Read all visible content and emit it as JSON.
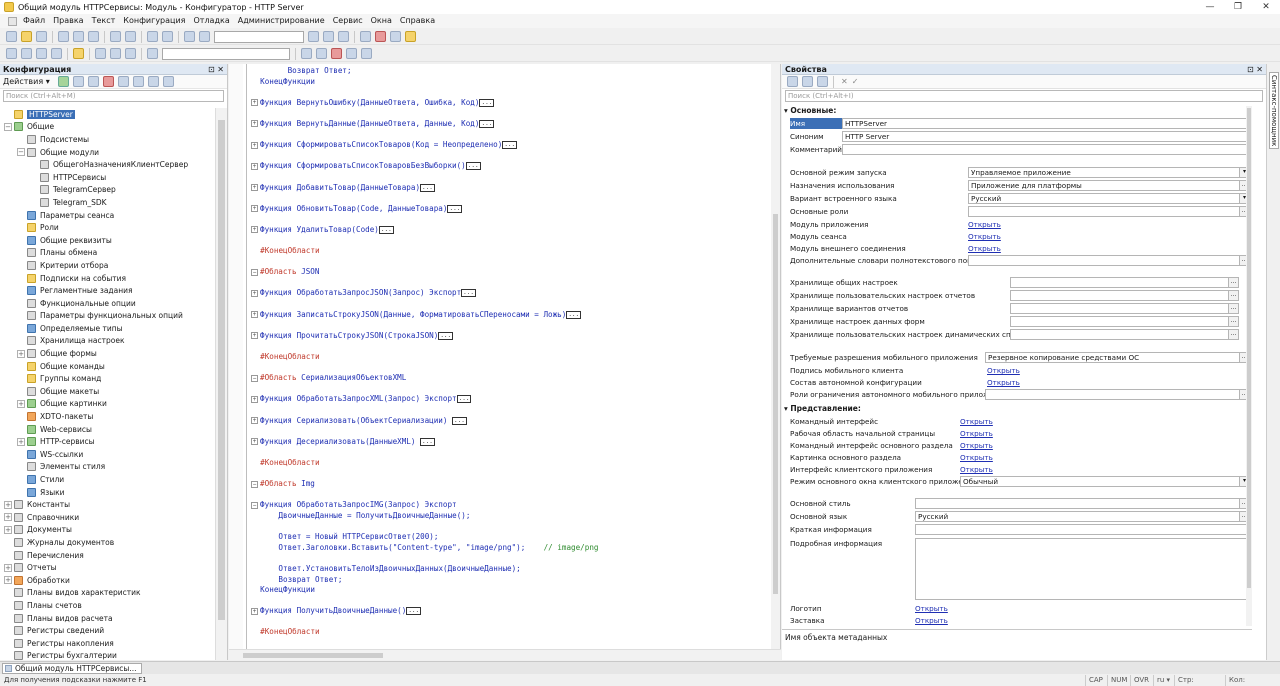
{
  "window": {
    "title": "Общий модуль HTTPСервисы: Модуль - Конфигуратор - HTTP Server",
    "min": "—",
    "max": "❐",
    "close": "✕"
  },
  "menu": [
    "Файл",
    "Правка",
    "Текст",
    "Конфигурация",
    "Отладка",
    "Администрирование",
    "Сервис",
    "Окна",
    "Справка"
  ],
  "left": {
    "title": "Конфигурация",
    "actions": "Действия ▾",
    "search_placeholder": "Поиск (Ctrl+Alt+M)",
    "tree": [
      {
        "label": "HTTPServer",
        "lvl": 0,
        "exp": "",
        "ic": "y",
        "sel": true
      },
      {
        "label": "Общие",
        "lvl": 0,
        "exp": "−",
        "ic": "g"
      },
      {
        "label": "Подсистемы",
        "lvl": 1,
        "exp": "",
        "ic": "d"
      },
      {
        "label": "Общие модули",
        "lvl": 1,
        "exp": "−",
        "ic": "d"
      },
      {
        "label": "ОбщегоНазначенияКлиентСервер",
        "lvl": 2,
        "exp": "",
        "ic": "d"
      },
      {
        "label": "HTTPСервисы",
        "lvl": 2,
        "exp": "",
        "ic": "d"
      },
      {
        "label": "TelegramСервер",
        "lvl": 2,
        "exp": "",
        "ic": "d"
      },
      {
        "label": "Telegram_SDK",
        "lvl": 2,
        "exp": "",
        "ic": "d"
      },
      {
        "label": "Параметры сеанса",
        "lvl": 1,
        "exp": "",
        "ic": "b"
      },
      {
        "label": "Роли",
        "lvl": 1,
        "exp": "",
        "ic": "y"
      },
      {
        "label": "Общие реквизиты",
        "lvl": 1,
        "exp": "",
        "ic": "b"
      },
      {
        "label": "Планы обмена",
        "lvl": 1,
        "exp": "",
        "ic": "d"
      },
      {
        "label": "Критерии отбора",
        "lvl": 1,
        "exp": "",
        "ic": "d"
      },
      {
        "label": "Подписки на события",
        "lvl": 1,
        "exp": "",
        "ic": "y"
      },
      {
        "label": "Регламентные задания",
        "lvl": 1,
        "exp": "",
        "ic": "b"
      },
      {
        "label": "Функциональные опции",
        "lvl": 1,
        "exp": "",
        "ic": "d"
      },
      {
        "label": "Параметры функциональных опций",
        "lvl": 1,
        "exp": "",
        "ic": "d"
      },
      {
        "label": "Определяемые типы",
        "lvl": 1,
        "exp": "",
        "ic": "b"
      },
      {
        "label": "Хранилища настроек",
        "lvl": 1,
        "exp": "",
        "ic": "d"
      },
      {
        "label": "Общие формы",
        "lvl": 1,
        "exp": "+",
        "ic": "d"
      },
      {
        "label": "Общие команды",
        "lvl": 1,
        "exp": "",
        "ic": "y"
      },
      {
        "label": "Группы команд",
        "lvl": 1,
        "exp": "",
        "ic": "y"
      },
      {
        "label": "Общие макеты",
        "lvl": 1,
        "exp": "",
        "ic": "d"
      },
      {
        "label": "Общие картинки",
        "lvl": 1,
        "exp": "+",
        "ic": "g"
      },
      {
        "label": "XDTO-пакеты",
        "lvl": 1,
        "exp": "",
        "ic": "o"
      },
      {
        "label": "Web-сервисы",
        "lvl": 1,
        "exp": "",
        "ic": "g"
      },
      {
        "label": "HTTP-сервисы",
        "lvl": 1,
        "exp": "+",
        "ic": "g"
      },
      {
        "label": "WS-ссылки",
        "lvl": 1,
        "exp": "",
        "ic": "b"
      },
      {
        "label": "Элементы стиля",
        "lvl": 1,
        "exp": "",
        "ic": "d"
      },
      {
        "label": "Стили",
        "lvl": 1,
        "exp": "",
        "ic": "b"
      },
      {
        "label": "Языки",
        "lvl": 1,
        "exp": "",
        "ic": "b"
      },
      {
        "label": "Константы",
        "lvl": 0,
        "exp": "+",
        "ic": "d"
      },
      {
        "label": "Справочники",
        "lvl": 0,
        "exp": "+",
        "ic": "d"
      },
      {
        "label": "Документы",
        "lvl": 0,
        "exp": "+",
        "ic": "d"
      },
      {
        "label": "Журналы документов",
        "lvl": 0,
        "exp": "",
        "ic": "d"
      },
      {
        "label": "Перечисления",
        "lvl": 0,
        "exp": "",
        "ic": "d"
      },
      {
        "label": "Отчеты",
        "lvl": 0,
        "exp": "+",
        "ic": "d"
      },
      {
        "label": "Обработки",
        "lvl": 0,
        "exp": "+",
        "ic": "o"
      },
      {
        "label": "Планы видов характеристик",
        "lvl": 0,
        "exp": "",
        "ic": "d"
      },
      {
        "label": "Планы счетов",
        "lvl": 0,
        "exp": "",
        "ic": "d"
      },
      {
        "label": "Планы видов расчета",
        "lvl": 0,
        "exp": "",
        "ic": "d"
      },
      {
        "label": "Регистры сведений",
        "lvl": 0,
        "exp": "",
        "ic": "d"
      },
      {
        "label": "Регистры накопления",
        "lvl": 0,
        "exp": "",
        "ic": "d"
      },
      {
        "label": "Регистры бухгалтерии",
        "lvl": 0,
        "exp": "",
        "ic": "d"
      }
    ]
  },
  "code": [
    {
      "t": "        Возврат Ответ;",
      "f": ""
    },
    {
      "t": "  КонецФункции",
      "f": ""
    },
    {
      "t": "",
      "f": ""
    },
    {
      "t": "Функция ВернутьОшибку(ДанныеОтвета, Ошибка, Код)",
      "f": "+",
      "d": true
    },
    {
      "t": "",
      "f": ""
    },
    {
      "t": "Функция ВернутьДанные(ДанныеОтвета, Данные, Код)",
      "f": "+",
      "d": true
    },
    {
      "t": "",
      "f": ""
    },
    {
      "t": "Функция СформироватьСписокТоваров(Код = Неопределено)",
      "f": "+",
      "d": true
    },
    {
      "t": "",
      "f": ""
    },
    {
      "t": "Функция СформироватьСписокТоваровБезВыборки()",
      "f": "+",
      "d": true
    },
    {
      "t": "",
      "f": ""
    },
    {
      "t": "Функция ДобавитьТовар(ДанныеТовара)",
      "f": "+",
      "d": true
    },
    {
      "t": "",
      "f": ""
    },
    {
      "t": "Функция ОбновитьТовар(Code, ДанныеТовара)",
      "f": "+",
      "d": true
    },
    {
      "t": "",
      "f": ""
    },
    {
      "t": "Функция УдалитьТовар(Code)",
      "f": "+",
      "d": true
    },
    {
      "t": "",
      "f": ""
    },
    {
      "t": "  #КонецОбласти",
      "f": ""
    },
    {
      "t": "",
      "f": ""
    },
    {
      "t": "#Область JSON",
      "f": "−"
    },
    {
      "t": "",
      "f": ""
    },
    {
      "t": "Функция ОбработатьЗапросJSON(Запрос) Экспорт",
      "f": "+",
      "d": true
    },
    {
      "t": "",
      "f": ""
    },
    {
      "t": "Функция ЗаписатьСтрокуJSON(Данные, ФорматироватьСПереносами = Ложь)",
      "f": "+",
      "d": true
    },
    {
      "t": "",
      "f": ""
    },
    {
      "t": "Функция ПрочитатьСтрокуJSON(СтрокаJSON)",
      "f": "+",
      "d": true
    },
    {
      "t": "",
      "f": ""
    },
    {
      "t": "  #КонецОбласти",
      "f": ""
    },
    {
      "t": "",
      "f": ""
    },
    {
      "t": "#Область СериализацияОбъектовXML",
      "f": "−"
    },
    {
      "t": "",
      "f": ""
    },
    {
      "t": "Функция ОбработатьЗапросXML(Запрос) Экспорт",
      "f": "+",
      "d": true
    },
    {
      "t": "",
      "f": ""
    },
    {
      "t": "Функция Сериализовать(ОбъектСериализации) ",
      "f": "+",
      "d": true
    },
    {
      "t": "",
      "f": ""
    },
    {
      "t": "Функция Десериализовать(ДанныеXML) ",
      "f": "+",
      "d": true
    },
    {
      "t": "",
      "f": ""
    },
    {
      "t": "  #КонецОбласти",
      "f": ""
    },
    {
      "t": "",
      "f": ""
    },
    {
      "t": "#Область Img",
      "f": "−"
    },
    {
      "t": "",
      "f": ""
    },
    {
      "t": "Функция ОбработатьЗапросIMG(Запрос) Экспорт",
      "f": "−"
    },
    {
      "t": "      ДвоичныеДанные = ПолучитьДвоичныеДанные();",
      "f": ""
    },
    {
      "t": "",
      "f": ""
    },
    {
      "t": "      Ответ = Новый HTTPСервисОтвет(200);",
      "f": ""
    },
    {
      "t": "      Ответ.Заголовки.Вставить(\"Content-type\", \"image/png\");    // image/png",
      "f": ""
    },
    {
      "t": "",
      "f": ""
    },
    {
      "t": "      Ответ.УстановитьТелоИзДвоичныхДанных(ДвоичныеДанные);",
      "f": ""
    },
    {
      "t": "      Возврат Ответ;",
      "f": ""
    },
    {
      "t": "  КонецФункции",
      "f": ""
    },
    {
      "t": "",
      "f": ""
    },
    {
      "t": "Функция ПолучитьДвоичныеДанные()",
      "f": "+",
      "d": true
    },
    {
      "t": "",
      "f": ""
    },
    {
      "t": "  #КонецОбласти",
      "f": ""
    }
  ],
  "props": {
    "title": "Свойства",
    "search_placeholder": "Поиск (Ctrl+Alt+I)",
    "sec_basic": "Основные:",
    "sec_view": "Представление:",
    "link": "Открыть",
    "name_label": "Имя",
    "name_value": "HTTPServer",
    "syn_label": "Синоним",
    "syn_value": "HTTP Server",
    "comment_label": "Комментарий",
    "launch_label": "Основной режим запуска",
    "launch_value": "Управляемое приложение",
    "purpose_label": "Назначения использования",
    "purpose_value": "Приложение для платформы",
    "lang_variant_label": "Вариант встроенного языка",
    "lang_variant_value": "Русский",
    "roles_label": "Основные роли",
    "appmod_label": "Модуль приложения",
    "sessmod_label": "Модуль сеанса",
    "extconn_label": "Модуль внешнего соединения",
    "dict_label": "Дополнительные словари полнотекстового поиска",
    "st1": "Хранилище общих настроек",
    "st2": "Хранилище пользовательских настроек отчетов",
    "st3": "Хранилище вариантов отчетов",
    "st4": "Хранилище настроек данных форм",
    "st5": "Хранилище пользовательских настроек динамических списков",
    "mob_perm_label": "Требуемые разрешения мобильного приложения",
    "mob_perm_value": "Резервное копирование средствами ОС",
    "mob_sign_label": "Подпись мобильного клиента",
    "auto_conf_label": "Состав автономной конфигурации",
    "mob_roles_label": "Роли ограничения автономного мобильного приложения",
    "cmd_if_label": "Командный интерфейс",
    "home_label": "Рабочая область начальной страницы",
    "main_cmd_label": "Командный интерфейс основного раздела",
    "main_pic_label": "Картинка основного раздела",
    "client_if_label": "Интерфейс клиентского приложения",
    "win_mode_label": "Режим основного окна клиентского приложения",
    "win_mode_value": "Обычный",
    "style_label": "Основной стиль",
    "main_lang_label": "Основной язык",
    "main_lang_value": "Русский",
    "short_label": "Краткая информация",
    "detail_label": "Подробная информация",
    "logo_label": "Логотип",
    "splash_label": "Заставка",
    "desc": "Имя объекта метаданных"
  },
  "right_strip": "Синтакс-помощник",
  "tab": "Общий модуль HTTPСервисы...",
  "status": {
    "hint": "Для получения подсказки нажмите F1",
    "cap": "CAP",
    "num": "NUM",
    "ovr": "OVR",
    "lang": "ru ▾",
    "str": "Стр:",
    "col": "Кол:"
  }
}
